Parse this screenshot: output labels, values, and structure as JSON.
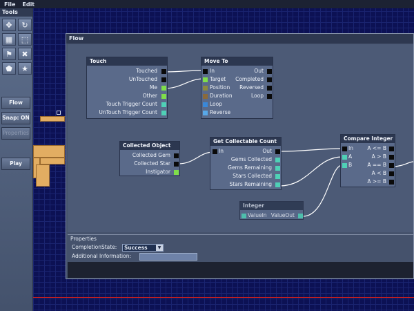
{
  "menu": {
    "file": "File",
    "edit": "Edit"
  },
  "sidebar": {
    "title": "Tools",
    "tools": [
      {
        "icon": "move-icon",
        "glyph": "✥"
      },
      {
        "icon": "rotate-icon",
        "glyph": "↻"
      },
      {
        "icon": "tile-icon",
        "glyph": "▦"
      },
      {
        "icon": "select-region-icon",
        "glyph": "⬚"
      },
      {
        "icon": "flag-icon",
        "glyph": "⚑"
      },
      {
        "icon": "cross-tool-icon",
        "glyph": "✖"
      },
      {
        "icon": "shield-icon",
        "glyph": "⬟"
      },
      {
        "icon": "star-icon",
        "glyph": "★"
      }
    ],
    "flow": "Flow",
    "snap": "Snap: ON",
    "properties": "Properties",
    "play": "Play"
  },
  "window": {
    "title": "Flow"
  },
  "nodes": {
    "touch": {
      "title": "Touch",
      "ports": [
        "Touched",
        "UnTouched",
        "Me",
        "Other",
        "Touch Trigger Count",
        "UnTouch Trigger Count"
      ]
    },
    "moveto": {
      "title": "Move To",
      "inputs": [
        "In",
        "Target",
        "Position",
        "Duration",
        "Loop",
        "Reverse"
      ],
      "outputs": [
        "Out",
        "Completed",
        "Reversed",
        "Loop"
      ]
    },
    "collected": {
      "title": "Collected Object",
      "ports": [
        "Collected Gem",
        "Collected Star",
        "Instigator"
      ]
    },
    "getcount": {
      "title": "Get Collectable Count",
      "input": "In",
      "output": "Out",
      "ports": [
        "Gems Collected",
        "Gems Remaining",
        "Stars Collected",
        "Stars Remaining"
      ]
    },
    "integer": {
      "title": "Integer",
      "input": "ValueIn",
      "output": "ValueOut"
    },
    "compare": {
      "title": "Compare Integer",
      "inputs": [
        "In",
        "A",
        "B"
      ],
      "outputs": [
        "A <= B",
        "A > B",
        "A == B",
        "A < B",
        "A >= B"
      ]
    }
  },
  "properties": {
    "title": "Properties",
    "completion_label": "CompletionState:",
    "completion_value": "Success",
    "info_label": "Additional Information:",
    "info_value": ""
  }
}
